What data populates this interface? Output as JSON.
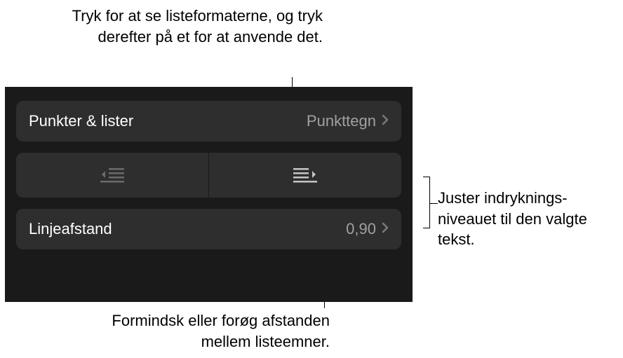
{
  "callouts": {
    "top": "Tryk for at se listeformaterne, og tryk derefter på et for at anvende det.",
    "right": "Juster indryknings-niveauet til den valgte tekst.",
    "bottom": "Formindsk eller forøg afstanden mellem listeemner."
  },
  "rows": {
    "bullets": {
      "label": "Punkter & lister",
      "value": "Punkttegn"
    },
    "lineSpacing": {
      "label": "Linjeafstand",
      "value": "0,90"
    }
  },
  "iconNames": {
    "outdent": "outdent-icon",
    "indent": "indent-icon",
    "chevron": "chevron-right-icon"
  }
}
